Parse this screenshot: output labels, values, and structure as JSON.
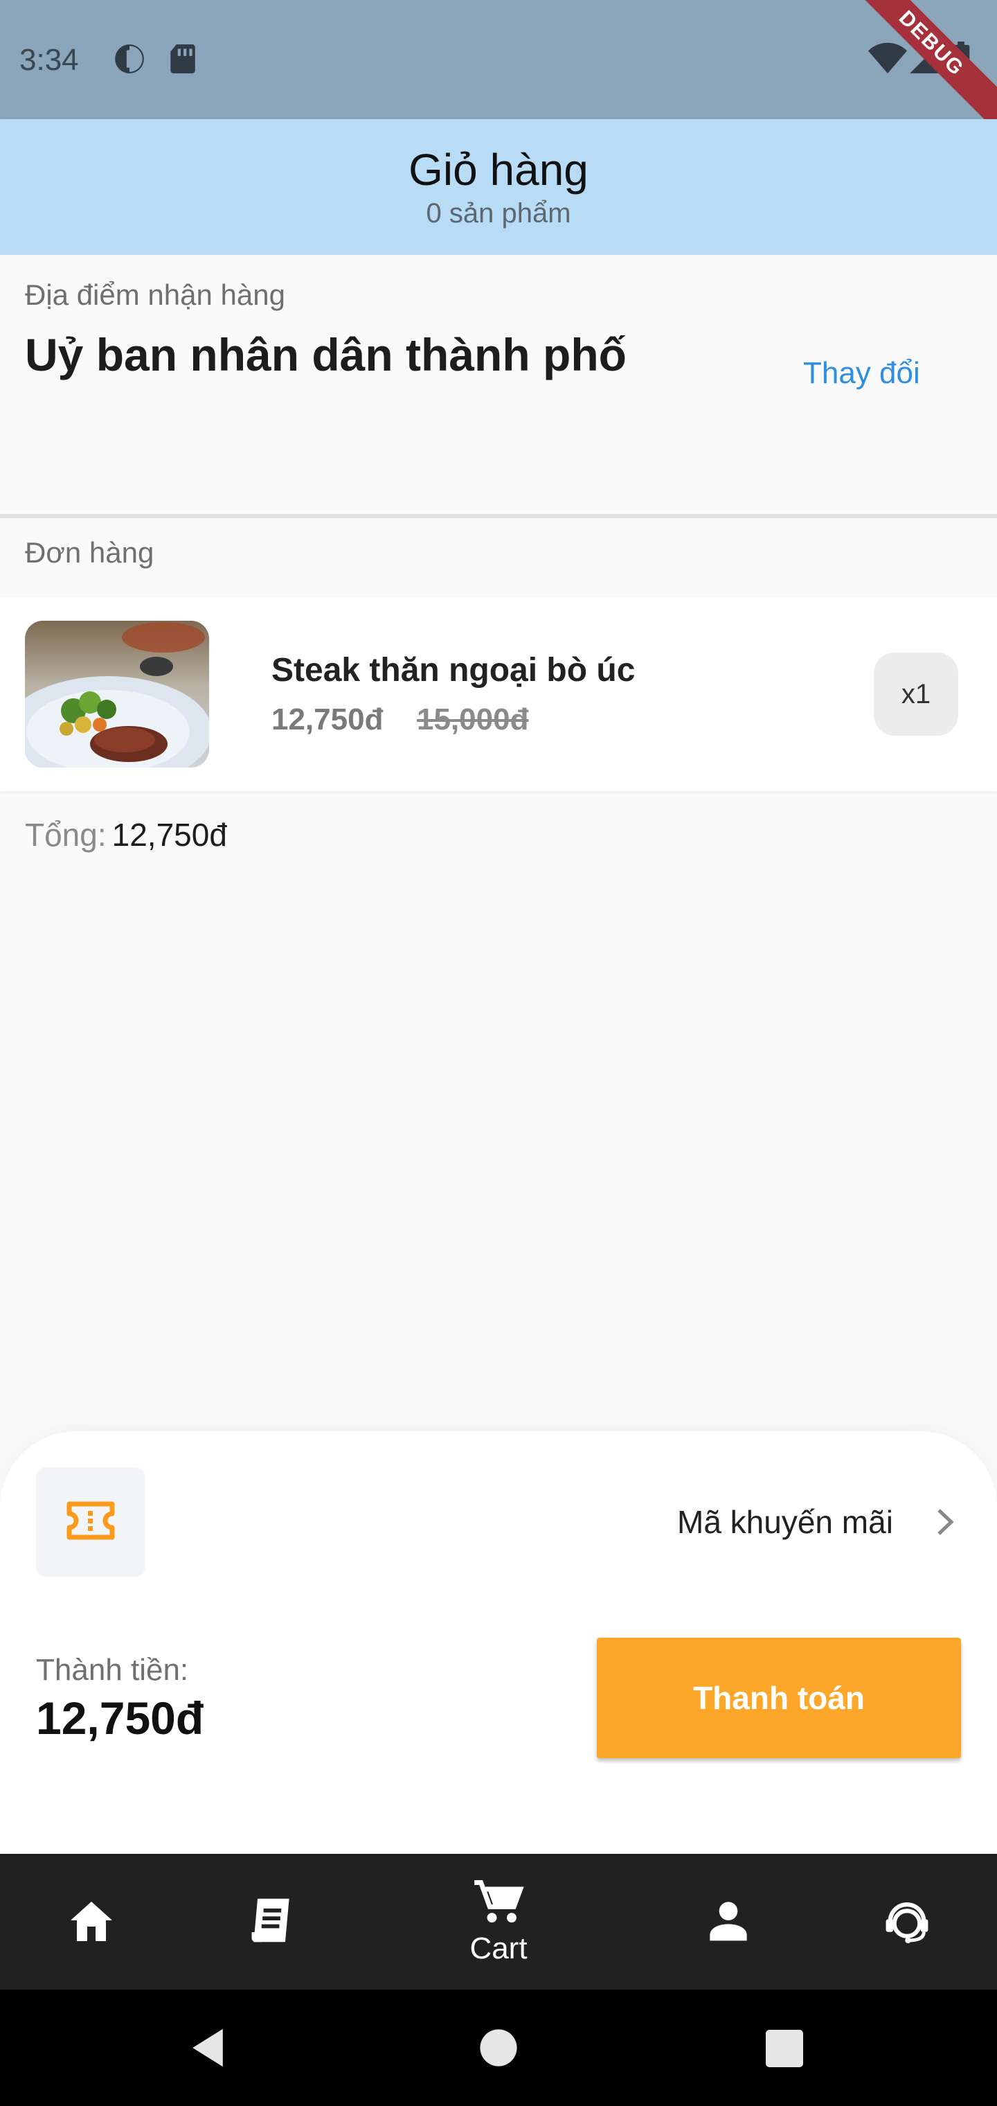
{
  "status_bar": {
    "time": "3:34",
    "debug_label": "DEBUG",
    "icons": [
      "data-saver-icon",
      "sd-card-icon",
      "wifi-icon",
      "signal-icon",
      "battery-icon"
    ]
  },
  "header": {
    "title": "Giỏ hàng",
    "subtitle": "0 sản phẩm",
    "background": "#b9dcf6"
  },
  "location": {
    "label": "Địa điểm nhận hàng",
    "name": "Uỷ ban nhân dân thành phố",
    "change_label": "Thay đổi"
  },
  "order": {
    "section_label": "Đơn hàng",
    "items": [
      {
        "name": "Steak thăn ngoại bò úc",
        "price": "12,750đ",
        "original_price": "15,000đ",
        "quantity": "x1"
      }
    ],
    "total_label": "Tổng:",
    "total_value": "12,750đ"
  },
  "checkout": {
    "promo_label": "Mã khuyến mãi",
    "amount_label": "Thành tiền:",
    "amount_value": "12,750đ",
    "pay_label": "Thanh toán",
    "accent": "#fda72a"
  },
  "bottom_nav": {
    "items": [
      {
        "icon": "home-icon",
        "label": ""
      },
      {
        "icon": "receipt-icon",
        "label": ""
      },
      {
        "icon": "cart-icon",
        "label": "Cart"
      },
      {
        "icon": "person-icon",
        "label": ""
      },
      {
        "icon": "support-agent-icon",
        "label": ""
      }
    ],
    "active_index": 2
  }
}
